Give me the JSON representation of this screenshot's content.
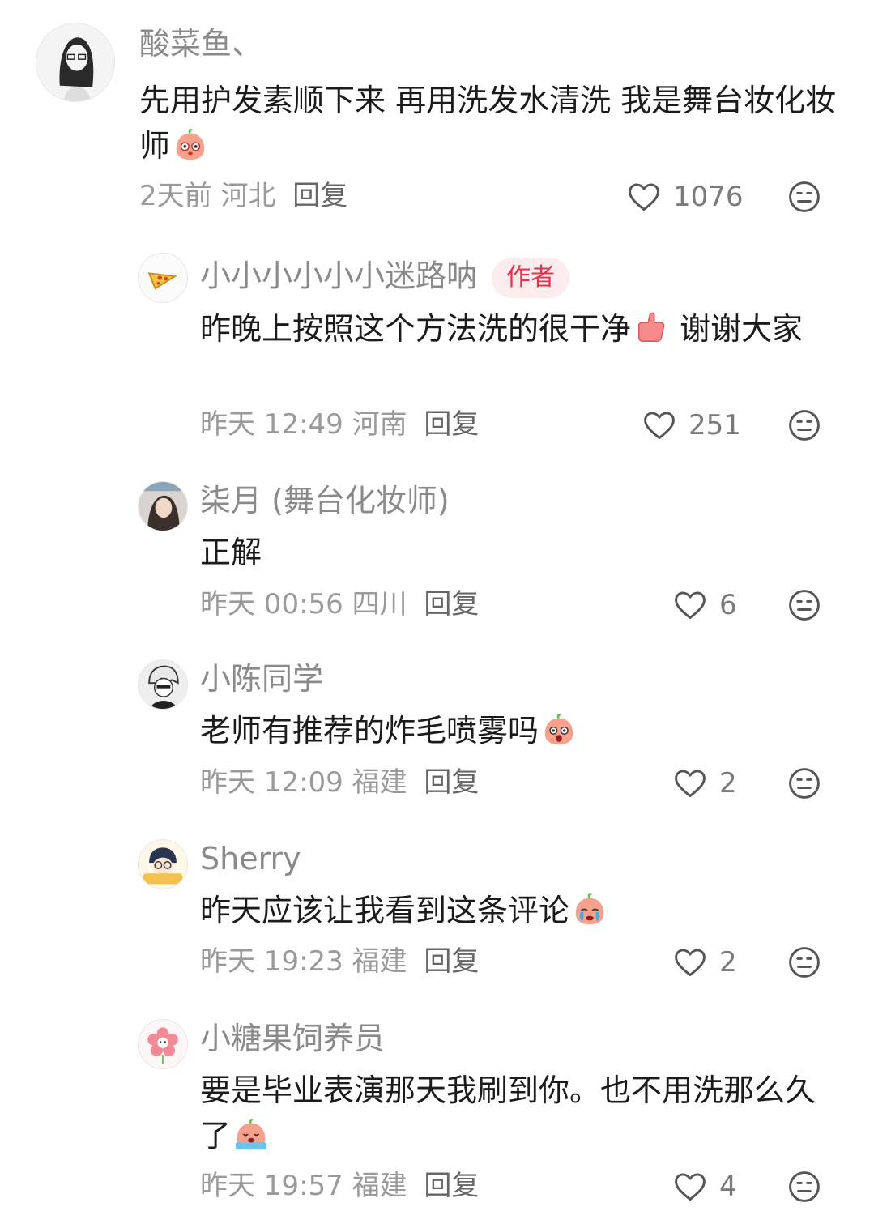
{
  "comments": [
    {
      "name": "酸菜鱼、",
      "text": "先用护发素顺下来 再用洗发水清洗 我是舞台妆化妆师",
      "time": "2天前",
      "location": "河北",
      "reply": "回复",
      "likes": "1076",
      "emoji": "peach-wow-emoji"
    },
    {
      "name": "小小小小小小迷路呐",
      "badge": "作者",
      "text1": "昨晚上按照这个方法洗的很干净",
      "text2": " 谢谢大家",
      "time": "昨天 12:49",
      "location": "河南",
      "reply": "回复",
      "likes": "251",
      "emoji": "thumbs-up-emoji"
    },
    {
      "name": "柒月 (舞台化妆师)",
      "text": "正解",
      "time": "昨天 00:56",
      "location": "四川",
      "reply": "回复",
      "likes": "6"
    },
    {
      "name": "小陈同学",
      "text": "老师有推荐的炸毛喷雾吗",
      "time": "昨天 12:09",
      "location": "福建",
      "reply": "回复",
      "likes": "2",
      "emoji": "peach-shock-emoji"
    },
    {
      "name": "Sherry",
      "text": "昨天应该让我看到这条评论",
      "time": "昨天 19:23",
      "location": "福建",
      "reply": "回复",
      "likes": "2",
      "emoji": "peach-cry-emoji"
    },
    {
      "name": "小糖果饲养员",
      "text": "要是毕业表演那天我刷到你。也不用洗那么久了",
      "time": "昨天 19:57",
      "location": "福建",
      "reply": "回复",
      "likes": "4",
      "emoji": "peach-sob-emoji"
    }
  ],
  "colors": {
    "author_badge_bg": "#fdeced",
    "author_badge_text": "#e0344c",
    "peach": "#f7a08c"
  }
}
